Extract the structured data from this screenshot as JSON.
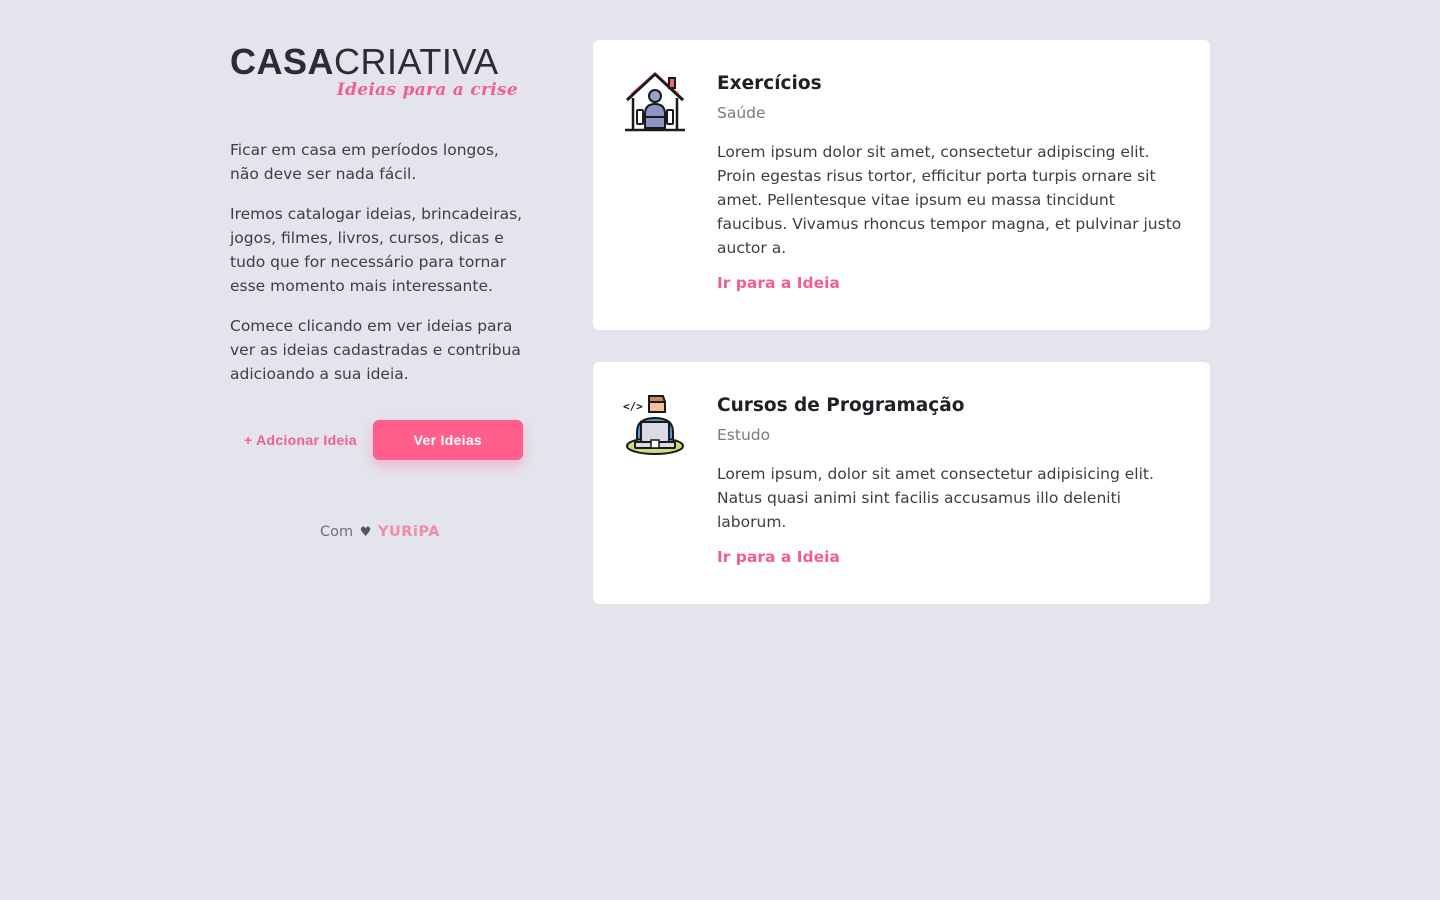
{
  "brand": {
    "name_bold": "CASA",
    "name_thin": "CRIATIVA",
    "tagline": "Ideias para a crise",
    "accent_color": "#ff5f8a"
  },
  "intro": {
    "paragraphs": [
      "Ficar em casa em períodos longos, não deve ser nada fácil.",
      "Iremos catalogar ideias, brincadeiras, jogos, filmes, livros, cursos, dicas e tudo que for necessário para tornar esse momento mais interessante.",
      "Comece clicando em ver ideias para ver as ideias cadastradas e contribua adicioando a sua ideia."
    ]
  },
  "actions": {
    "add_label": "+ Adcionar Ideia",
    "view_label": "Ver Ideias"
  },
  "footer": {
    "prefix": "Com",
    "heart": "♥",
    "author": "YURiPA"
  },
  "ideas": [
    {
      "icon": "house-exercise-icon",
      "title": "Exercícios",
      "category": "Saúde",
      "description": "Lorem ipsum dolor sit amet, consectetur adipiscing elit. Proin egestas risus tortor, efficitur porta turpis ornare sit amet. Pellentesque vitae ipsum eu massa tincidunt faucibus. Vivamus rhoncus tempor magna, et pulvinar justo auctor a.",
      "link_label": "Ir para a Ideia"
    },
    {
      "icon": "programmer-laptop-icon",
      "title": "Cursos de Programação",
      "category": "Estudo",
      "description": "Lorem ipsum, dolor sit amet consectetur adipisicing elit. Natus quasi animi sint facilis accusamus illo deleniti laborum.",
      "link_label": "Ir para a Ideia"
    }
  ]
}
